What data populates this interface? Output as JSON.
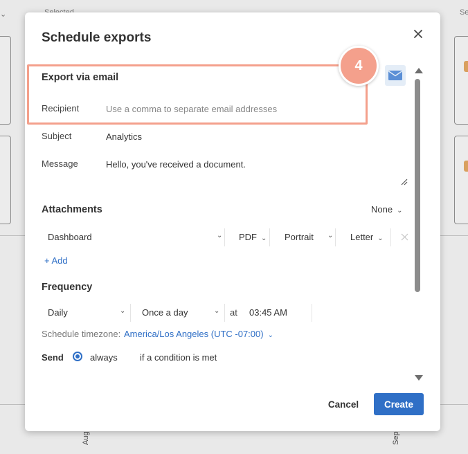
{
  "background": {
    "top_left_text": "Selected",
    "top_right_text": "Se",
    "axis_label_left": "Aug",
    "axis_label_right": "Sep"
  },
  "modal": {
    "title": "Schedule exports",
    "close_icon": "close-icon",
    "step_badge": "4",
    "email_section": {
      "title": "Export via email",
      "recipient_label": "Recipient",
      "recipient_placeholder": "Use a comma to separate email addresses",
      "subject_label": "Subject",
      "subject_value": "Analytics",
      "message_label": "Message",
      "message_value": "Hello, you've received a document.",
      "mail_icon": "envelope-icon"
    },
    "attachments": {
      "title": "Attachments",
      "none_option": "None",
      "item": {
        "type": "Dashboard",
        "format": "PDF",
        "orientation": "Portrait",
        "paper": "Letter"
      },
      "add_link": "+ Add"
    },
    "frequency": {
      "title": "Frequency",
      "period": "Daily",
      "repeat": "Once a day",
      "at_label": "at",
      "time": "03:45 AM",
      "timezone_label": "Schedule timezone:",
      "timezone_value": "America/Los Angeles (UTC -07:00)",
      "send_label": "Send",
      "send_options": [
        "always",
        "if a condition is met"
      ],
      "send_selected": "always"
    },
    "buttons": {
      "cancel": "Cancel",
      "create": "Create"
    }
  },
  "colors": {
    "accent": "#2f6fc6",
    "highlight": "#f4a08c",
    "overlay_bg": "#e9e9e9"
  }
}
